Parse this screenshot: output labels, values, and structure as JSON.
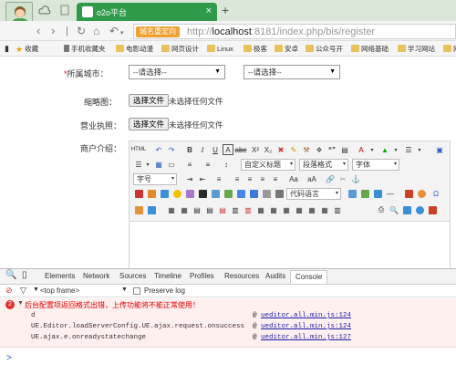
{
  "browser": {
    "tab_title": "o2o平台",
    "url_badge": "城名重定向",
    "url_prefix": "http://",
    "url_host": "localhost",
    "url_rest": ":8181/index.php/bis/register",
    "new_tab": "+",
    "close_tab": "×"
  },
  "bookmarks": [
    "收藏",
    "手机收藏夹",
    "电影动漫",
    "网页设计",
    "Linux",
    "极客",
    "安卓",
    "公众号开",
    "网络基础",
    "学习网站",
    "网"
  ],
  "form": {
    "city_label_required": "*",
    "city_label": "所属城市：",
    "city_select": "--请选择--",
    "city_select2": "--请选择--",
    "thumbnail_label": "缩略图：",
    "license_label": "营业执照：",
    "file_button": "选择文件",
    "file_note": "未选择任何文件",
    "intro_label": "商户介绍："
  },
  "editor": {
    "custom_title": "自定义标题",
    "paragraph": "段落格式",
    "font": "字体",
    "size": "字号",
    "code_lang": "代码语言"
  },
  "devtools": {
    "tabs": [
      "Elements",
      "Network",
      "Sources",
      "Timeline",
      "Profiles",
      "Resources",
      "Audits",
      "Console"
    ],
    "frame": "<top frame>",
    "preserve_log": "Preserve log",
    "error_count": "2",
    "error_message": "后台配置项返回格式出错，上传功能将不能正常使用！",
    "stack": [
      {
        "fn": "d",
        "src": "ueditor.all.min.js:124"
      },
      {
        "fn": "UE.Editor.loadServerConfig.UE.ajax.request.onsuccess",
        "src": "ueditor.all.min.js:124"
      },
      {
        "fn": "UE.ajax.e.onreadystatechange",
        "src": "ueditor.all.min.js:127"
      }
    ],
    "at": "@",
    "prompt": ">"
  },
  "colors": {
    "tab_green": "#2f9b4a",
    "error_bg": "#fff0f0",
    "error_text": "#e00000",
    "link": "#1a1aa6"
  }
}
